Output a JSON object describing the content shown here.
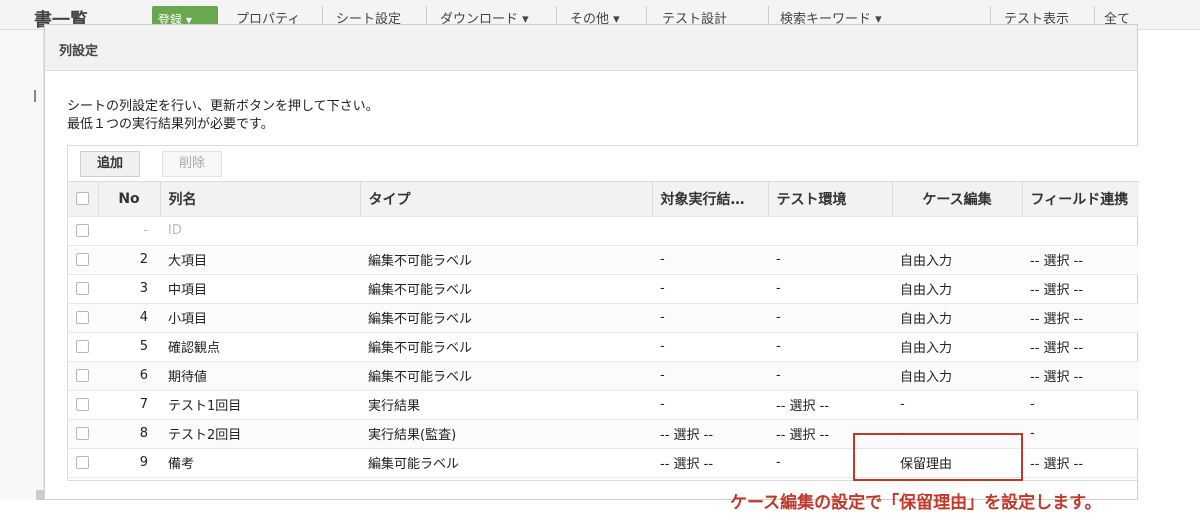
{
  "background_toolbar": {
    "title": "書一覧",
    "green_button": "登録 ▾",
    "items": [
      "プロパティ",
      "シート設定",
      "ダウンロード ▾",
      "その他 ▾",
      "テスト設計",
      "検索キーワード ▾",
      "テスト表示",
      "全て"
    ]
  },
  "modal": {
    "title": "列設定",
    "description_line1": "シートの列設定を行い、更新ボタンを押して下さい。",
    "description_line2": "最低１つの実行結果列が必要です。"
  },
  "toolbar": {
    "add_label": "追加",
    "delete_label": "削除"
  },
  "table": {
    "headers": [
      "No",
      "列名",
      "タイプ",
      "対象実行結…",
      "テスト環境",
      "ケース編集",
      "フィールド連携"
    ],
    "rows": [
      {
        "no": "-",
        "name": "ID",
        "type": "",
        "target": "",
        "env": "",
        "case_edit": "",
        "field": "",
        "disabled": true
      },
      {
        "no": "2",
        "name": "大項目",
        "type": "編集不可能ラベル",
        "target": "-",
        "env": "-",
        "case_edit": "自由入力",
        "field": "-- 選択 --"
      },
      {
        "no": "3",
        "name": "中項目",
        "type": "編集不可能ラベル",
        "target": "-",
        "env": "-",
        "case_edit": "自由入力",
        "field": "-- 選択 --"
      },
      {
        "no": "4",
        "name": "小項目",
        "type": "編集不可能ラベル",
        "target": "-",
        "env": "-",
        "case_edit": "自由入力",
        "field": "-- 選択 --"
      },
      {
        "no": "5",
        "name": "確認観点",
        "type": "編集不可能ラベル",
        "target": "-",
        "env": "-",
        "case_edit": "自由入力",
        "field": "-- 選択 --"
      },
      {
        "no": "6",
        "name": "期待値",
        "type": "編集不可能ラベル",
        "target": "-",
        "env": "-",
        "case_edit": "自由入力",
        "field": "-- 選択 --"
      },
      {
        "no": "7",
        "name": "テスト1回目",
        "type": "実行結果",
        "target": "-",
        "env": "-- 選択 --",
        "case_edit": "-",
        "field": "-"
      },
      {
        "no": "8",
        "name": "テスト2回目",
        "type": "実行結果(監査)",
        "target": "-- 選択 --",
        "env": "-- 選択 --",
        "case_edit": "-",
        "field": "-"
      },
      {
        "no": "9",
        "name": "備考",
        "type": "編集可能ラベル",
        "target": "-- 選択 --",
        "env": "-",
        "case_edit": "保留理由",
        "field": "-- 選択 --"
      }
    ]
  },
  "annotation": {
    "text": "ケース編集の設定で「保留理由」を設定します。",
    "color": "#c0392b"
  }
}
